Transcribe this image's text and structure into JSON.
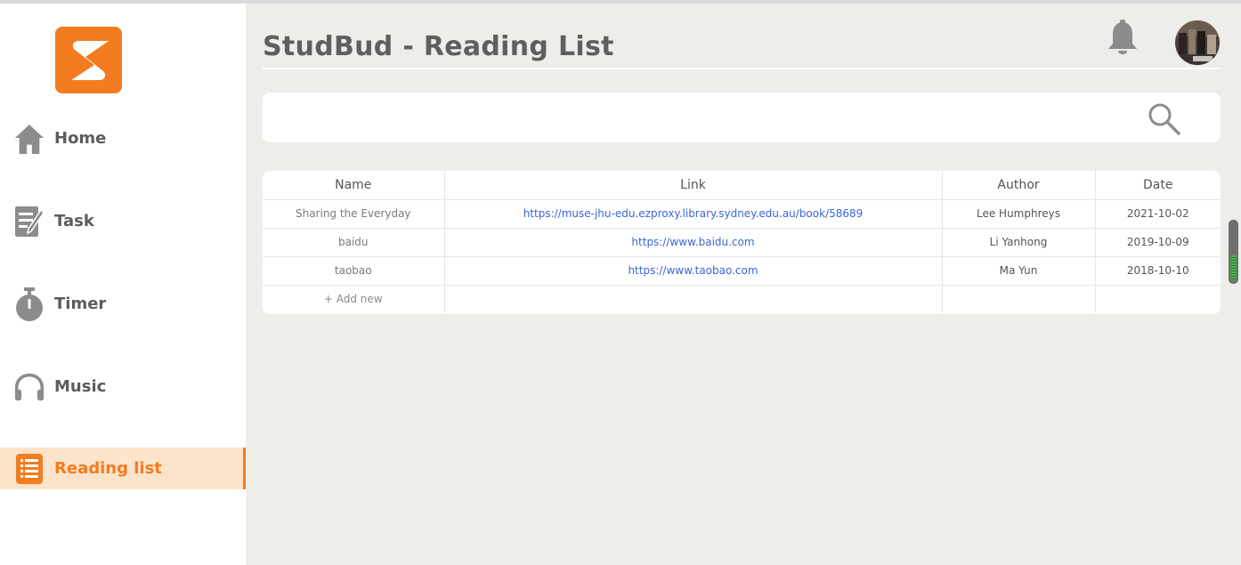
{
  "app": {
    "title": "StudBud - Reading List",
    "accent_color": "#f37c20",
    "logo_icon": "studbud-s-logo-icon"
  },
  "sidebar": {
    "items": [
      {
        "label": "Home",
        "icon": "home-icon",
        "active": false
      },
      {
        "label": "Task",
        "icon": "task-notepad-icon",
        "active": false
      },
      {
        "label": "Timer",
        "icon": "stopwatch-icon",
        "active": false
      },
      {
        "label": "Music",
        "icon": "headphones-icon",
        "active": false
      },
      {
        "label": "Reading list",
        "icon": "reading-list-icon",
        "active": true
      }
    ]
  },
  "header": {
    "notification_icon": "bell-icon",
    "avatar_icon": "user-avatar"
  },
  "search": {
    "value": "",
    "placeholder": "",
    "icon": "search-icon"
  },
  "table": {
    "columns": [
      "Name",
      "Link",
      "Author",
      "Date"
    ],
    "rows": [
      {
        "name": "Sharing the Everyday",
        "link": "https://muse-jhu-edu.ezproxy.library.sydney.edu.au/book/58689",
        "author": "Lee Humphreys",
        "date": "2021-10-02"
      },
      {
        "name": "baidu",
        "link": "https://www.baidu.com",
        "author": "Li Yanhong",
        "date": "2019-10-09"
      },
      {
        "name": "taobao",
        "link": "https://www.taobao.com",
        "author": "Ma Yun",
        "date": "2018-10-10"
      }
    ],
    "add_new_label": "+ Add new"
  }
}
